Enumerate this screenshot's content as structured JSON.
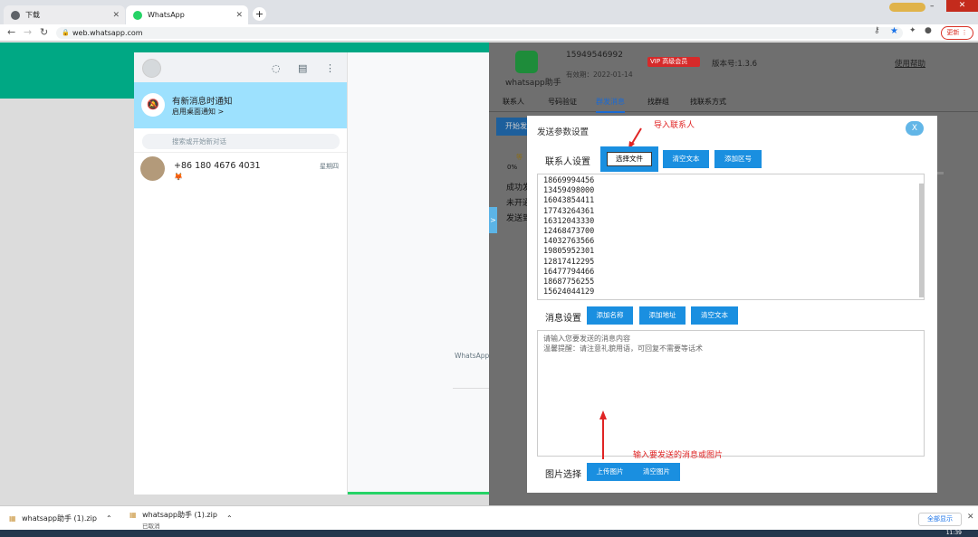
{
  "browser": {
    "tabs": [
      {
        "title": "下载"
      },
      {
        "title": "WhatsApp"
      }
    ],
    "url": "web.whatsapp.com",
    "update_label": "更新"
  },
  "whatsapp": {
    "notice_title": "有新消息时通知",
    "notice_sub": "启用桌面通知 >",
    "search_placeholder": "搜索或开始新对话",
    "chats": [
      {
        "name": "+86 180 4676 4031",
        "time": "星期四",
        "preview": "🦊"
      }
    ],
    "main_text": "WhatsApp"
  },
  "helper": {
    "app_name": "whatsapp助手",
    "phone": "15949546992",
    "expiry": "有效期：2022-01-14",
    "vip_label": "VIP 高级会员",
    "version": "版本号:1.3.6",
    "help_link": "使用帮助",
    "tabs": [
      "联系人",
      "号码验证",
      "群发消息",
      "找群组",
      "找联系方式"
    ],
    "active_tab": "群发消息",
    "start_button": "开始发",
    "side_items": [
      "成功发",
      "未开通",
      "发送到"
    ],
    "sliver": "等",
    "progress_text": "0%",
    "toggle_glyph": ">"
  },
  "modal": {
    "title": "发送参数设置",
    "close_label": "X",
    "contacts_label": "联系人设置",
    "choose_file": "选择文件",
    "clear_text": "清空文本",
    "add_area_code": "添加区号",
    "annotation_import": "导入联系人",
    "numbers": [
      "18669994456",
      "13459498000",
      "16043854411",
      "17743264361",
      "16312043330",
      "12468473700",
      "14032763566",
      "19805952301",
      "12817412295",
      "16477794466",
      "18687756255",
      "15624044129"
    ],
    "message_label": "消息设置",
    "add_name": "添加名称",
    "add_address": "添加地址",
    "clear_text2": "清空文本",
    "message_placeholder_line1": "请输入您要发送的消息内容",
    "message_placeholder_line2": "温馨提醒：请注意礼貌用语，可回复不需要等话术",
    "annotation_message": "输入要发送的消息或图片",
    "image_label": "图片选择",
    "upload_image": "上传图片",
    "clear_image": "清空图片"
  },
  "downloads": {
    "items": [
      {
        "name": "whatsapp助手 (1).zip",
        "status": ""
      },
      {
        "name": "whatsapp助手 (1).zip",
        "status": "已取消"
      }
    ],
    "show_all": "全部显示"
  },
  "taskbar": {
    "clock": "11:39"
  },
  "colors": {
    "accent": "#1a8fe0",
    "whatsapp_green": "#00a884",
    "annotation": "#e02424",
    "vip": "#d62a2a"
  }
}
